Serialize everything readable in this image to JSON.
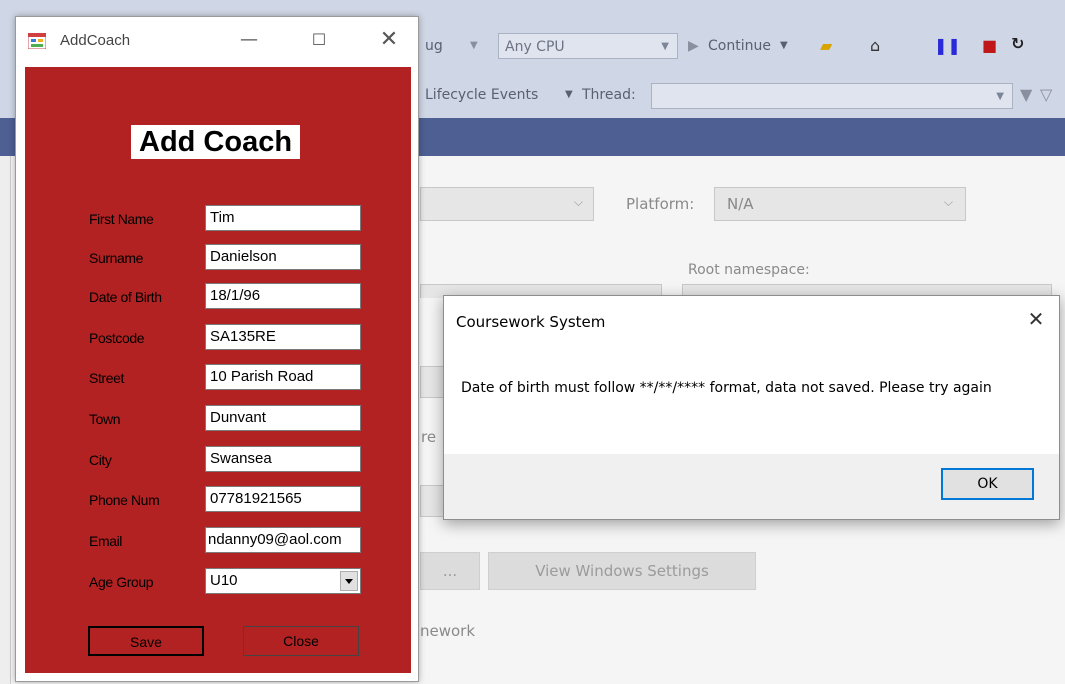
{
  "vs_toolbar": {
    "config_partial": "ug",
    "platform": "Any CPU",
    "continue_label": "Continue",
    "lifecycle_label": "Lifecycle Events",
    "thread_label": "Thread:"
  },
  "vs_properties": {
    "platform_label": "Platform:",
    "platform_value": "N/A",
    "root_namespace_label": "Root namespace:",
    "partial_re": "re",
    "ellipsis_button": "...",
    "view_windows_settings_button": "View Windows Settings",
    "partial_framework": "nework"
  },
  "form": {
    "window_title": "AddCoach",
    "heading": "Add Coach",
    "fields": [
      {
        "label": "First Name",
        "value": "Tim"
      },
      {
        "label": "Surname",
        "value": "Danielson"
      },
      {
        "label": "Date of Birth",
        "value": "18/1/96"
      },
      {
        "label": "Postcode",
        "value": "SA135RE"
      },
      {
        "label": "Street",
        "value": "10 Parish Road"
      },
      {
        "label": "Town",
        "value": "Dunvant"
      },
      {
        "label": "City",
        "value": "Swansea"
      },
      {
        "label": "Phone Num",
        "value": "07781921565"
      },
      {
        "label": "Email",
        "value": "ndanny09@aol.com"
      }
    ],
    "age_group": {
      "label": "Age Group",
      "value": "U10"
    },
    "save_button": "Save",
    "close_button": "Close",
    "colors": {
      "body": "#b22222"
    }
  },
  "dialog": {
    "title": "Coursework System",
    "message": "Date of birth must follow **/**/**** format, data not saved. Please try again",
    "ok_button": "OK"
  }
}
